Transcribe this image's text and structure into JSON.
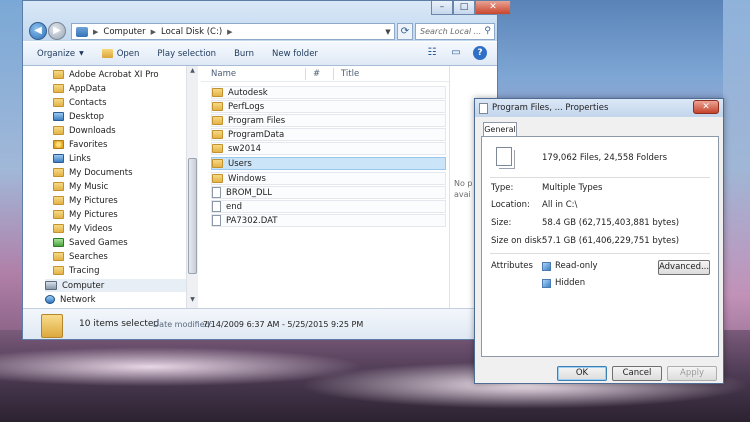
{
  "explorer": {
    "breadcrumb": [
      "Computer",
      "Local Disk (C:)"
    ],
    "search_placeholder": "Search Local ...",
    "toolbar": {
      "organize": "Organize",
      "open": "Open",
      "play_selection": "Play selection",
      "burn": "Burn",
      "new_folder": "New folder"
    },
    "nav_items": [
      {
        "label": "Adobe Acrobat XI Pro",
        "icon": "folder-icon"
      },
      {
        "label": "AppData",
        "icon": "folder-icon"
      },
      {
        "label": "Contacts",
        "icon": "folder-icon"
      },
      {
        "label": "Desktop",
        "icon": "folder-icon"
      },
      {
        "label": "Downloads",
        "icon": "folder-icon"
      },
      {
        "label": "Favorites",
        "icon": "favorites-icon"
      },
      {
        "label": "Links",
        "icon": "folder-icon"
      },
      {
        "label": "My Documents",
        "icon": "folder-icon"
      },
      {
        "label": "My Music",
        "icon": "folder-icon"
      },
      {
        "label": "My Pictures",
        "icon": "folder-icon"
      },
      {
        "label": "My Pictures",
        "icon": "folder-icon"
      },
      {
        "label": "My Videos",
        "icon": "folder-icon"
      },
      {
        "label": "Saved Games",
        "icon": "folder-icon"
      },
      {
        "label": "Searches",
        "icon": "folder-icon"
      },
      {
        "label": "Tracing",
        "icon": "folder-icon"
      }
    ],
    "nav_computer": "Computer",
    "nav_network": "Network",
    "columns": {
      "name": "Name",
      "num": "#",
      "title": "Title"
    },
    "files": [
      {
        "name": "Autodesk",
        "type": "folder"
      },
      {
        "name": "PerfLogs",
        "type": "folder"
      },
      {
        "name": "Program Files",
        "type": "folder"
      },
      {
        "name": "ProgramData",
        "type": "folder"
      },
      {
        "name": "sw2014",
        "type": "folder"
      },
      {
        "name": "Users",
        "type": "folder"
      },
      {
        "name": "Windows",
        "type": "folder"
      },
      {
        "name": "BROM_DLL",
        "type": "file"
      },
      {
        "name": "end",
        "type": "file"
      },
      {
        "name": "PA7302.DAT",
        "type": "file"
      }
    ],
    "preview_text": [
      "No p",
      "avai"
    ],
    "details": {
      "selected_count": "10 items selected",
      "date_label": "Date modified:",
      "date_value": "7/14/2009 6:37 AM - 5/25/2015 9:25 PM"
    }
  },
  "properties": {
    "title": "Program Files, ... Properties",
    "tab": "General",
    "summary": "179,062 Files, 24,558 Folders",
    "type_label": "Type:",
    "type_value": "Multiple Types",
    "location_label": "Location:",
    "location_value": "All in C:\\",
    "size_label": "Size:",
    "size_value": "58.4 GB (62,715,403,881 bytes)",
    "disk_label": "Size on disk:",
    "disk_value": "57.1 GB (61,406,229,751 bytes)",
    "attributes_label": "Attributes",
    "readonly_label": "Read-only",
    "hidden_label": "Hidden",
    "advanced_button": "Advanced...",
    "ok_button": "OK",
    "cancel_button": "Cancel",
    "apply_button": "Apply"
  }
}
